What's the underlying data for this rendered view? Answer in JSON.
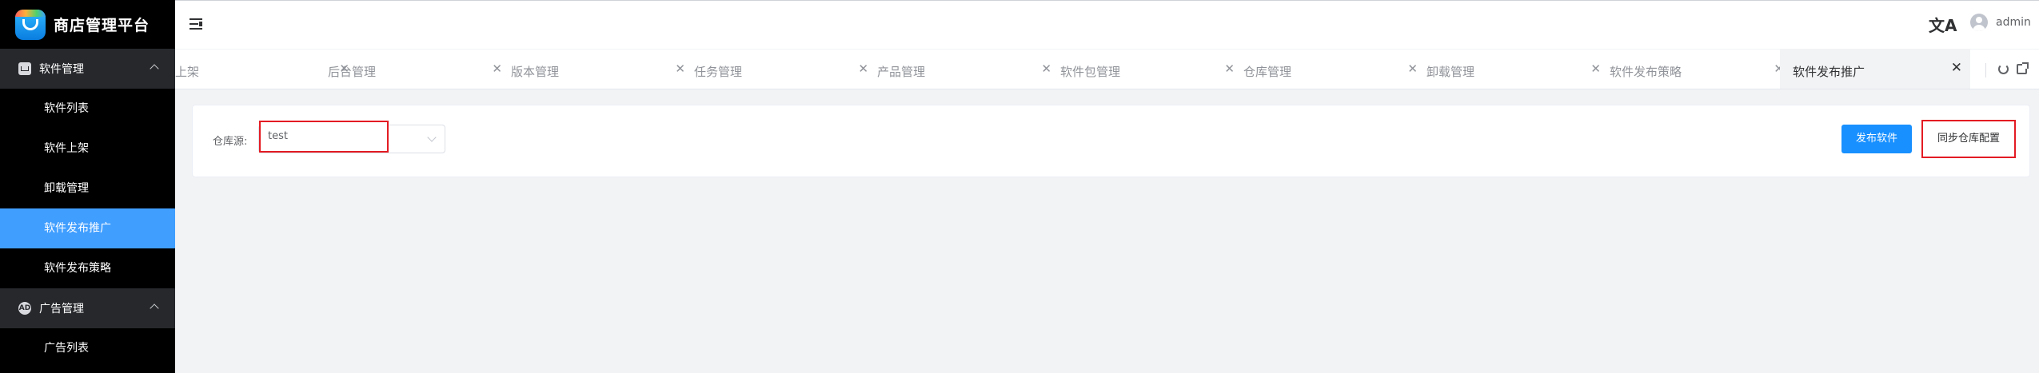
{
  "app": {
    "title": "商店管理平台"
  },
  "sidebar": {
    "groups": [
      {
        "label": "软件管理",
        "icon": "package-icon",
        "items": [
          {
            "label": "软件列表"
          },
          {
            "label": "软件上架"
          },
          {
            "label": "卸载管理"
          },
          {
            "label": "软件发布推广",
            "active": true
          },
          {
            "label": "软件发布策略"
          }
        ]
      },
      {
        "label": "广告管理",
        "icon": "ad-icon",
        "icon_text": "AD",
        "items": [
          {
            "label": "广告列表"
          }
        ]
      }
    ]
  },
  "header": {
    "language_icon": "文A",
    "username": "admin"
  },
  "tabs": [
    {
      "label": "上架"
    },
    {
      "label": "后台管理"
    },
    {
      "label": "版本管理"
    },
    {
      "label": "任务管理"
    },
    {
      "label": "产品管理"
    },
    {
      "label": "软件包管理"
    },
    {
      "label": "仓库管理"
    },
    {
      "label": "卸载管理"
    },
    {
      "label": "软件发布策略"
    },
    {
      "label": "软件发布推广",
      "active": true
    }
  ],
  "tab_close_glyph": "✕",
  "filter": {
    "label": "仓库源:",
    "value": "test"
  },
  "actions": {
    "publish_label": "发布软件",
    "sync_label": "同步仓库配置"
  },
  "colors": {
    "sidebar_bg": "#000000",
    "active_item": "#409eff",
    "primary_button": "#1890ff",
    "highlight_border": "#e31b23"
  }
}
